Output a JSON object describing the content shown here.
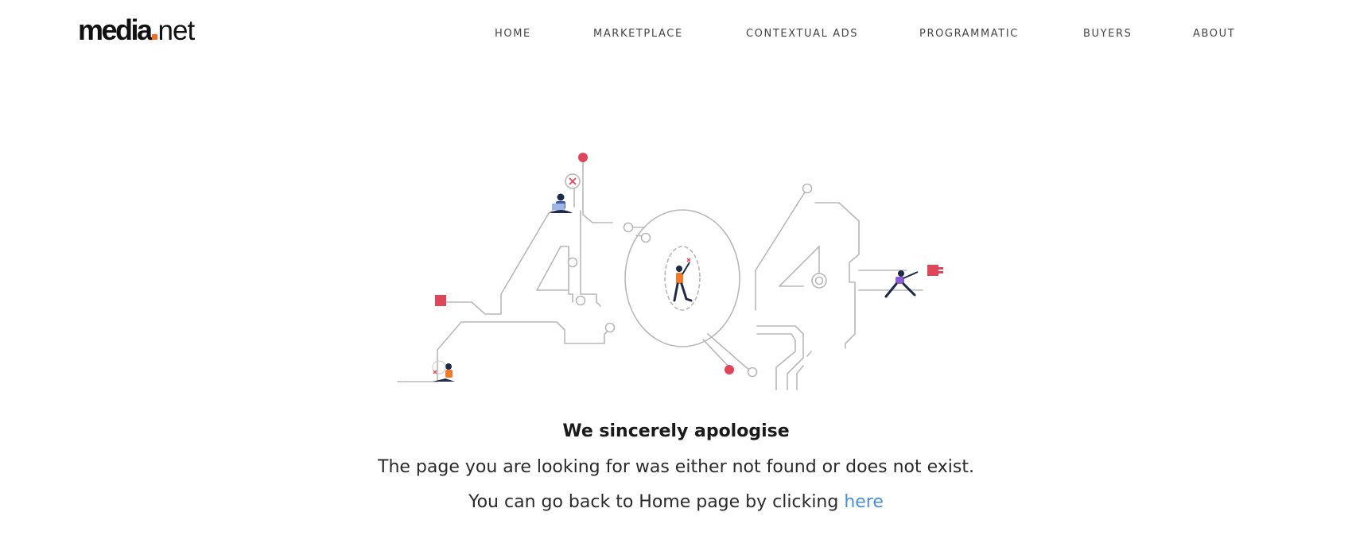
{
  "header": {
    "logo": {
      "word1": "media",
      "word2": "net",
      "dot_color": "#f26b21"
    },
    "nav": [
      {
        "label": "HOME"
      },
      {
        "label": "MARKETPLACE"
      },
      {
        "label": "CONTEXTUAL ADS"
      },
      {
        "label": "PROGRAMMATIC"
      },
      {
        "label": "BUYERS"
      },
      {
        "label": "ABOUT"
      }
    ]
  },
  "illustration": {
    "icon": "404-circuit-illustration",
    "accent_color": "#e0465a",
    "line_color": "#b8b8b8"
  },
  "message": {
    "title": "We sincerely apologise",
    "line1": "The page you are looking for was either not found or does not exist.",
    "line2_prefix": "You can go back to Home page by clicking ",
    "link_label": "here",
    "link_color": "#4a8fd8"
  }
}
